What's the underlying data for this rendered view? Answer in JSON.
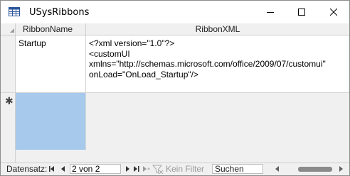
{
  "window": {
    "title": "USysRibbons"
  },
  "columns": [
    {
      "label": "RibbonName"
    },
    {
      "label": "RibbonXML"
    }
  ],
  "rows": [
    {
      "ribbon_name": "Startup",
      "ribbon_xml_lines": [
        "<?xml version=\"1.0\"?>",
        "<customUI",
        "xmlns=\"http://schemas.microsoft.com/office/2009/07/customui\"",
        "onLoad=\"OnLoad_Startup\"/>"
      ]
    }
  ],
  "new_row_marker": "✱",
  "navigation": {
    "label": "Datensatz:",
    "current": "2 von 2",
    "filter_label": "Kein Filter",
    "search_placeholder": "Suchen"
  },
  "colors": {
    "selected_cell": "#a6c9ec",
    "header_bg": "#f0f0f0"
  },
  "icons": {
    "title": "table-icon",
    "minimize": "minimize-icon",
    "maximize": "maximize-icon",
    "close": "close-icon",
    "first": "first-record-icon",
    "prev": "previous-record-icon",
    "next": "next-record-icon",
    "last": "last-record-icon",
    "new": "new-record-icon",
    "filter": "filter-icon"
  }
}
